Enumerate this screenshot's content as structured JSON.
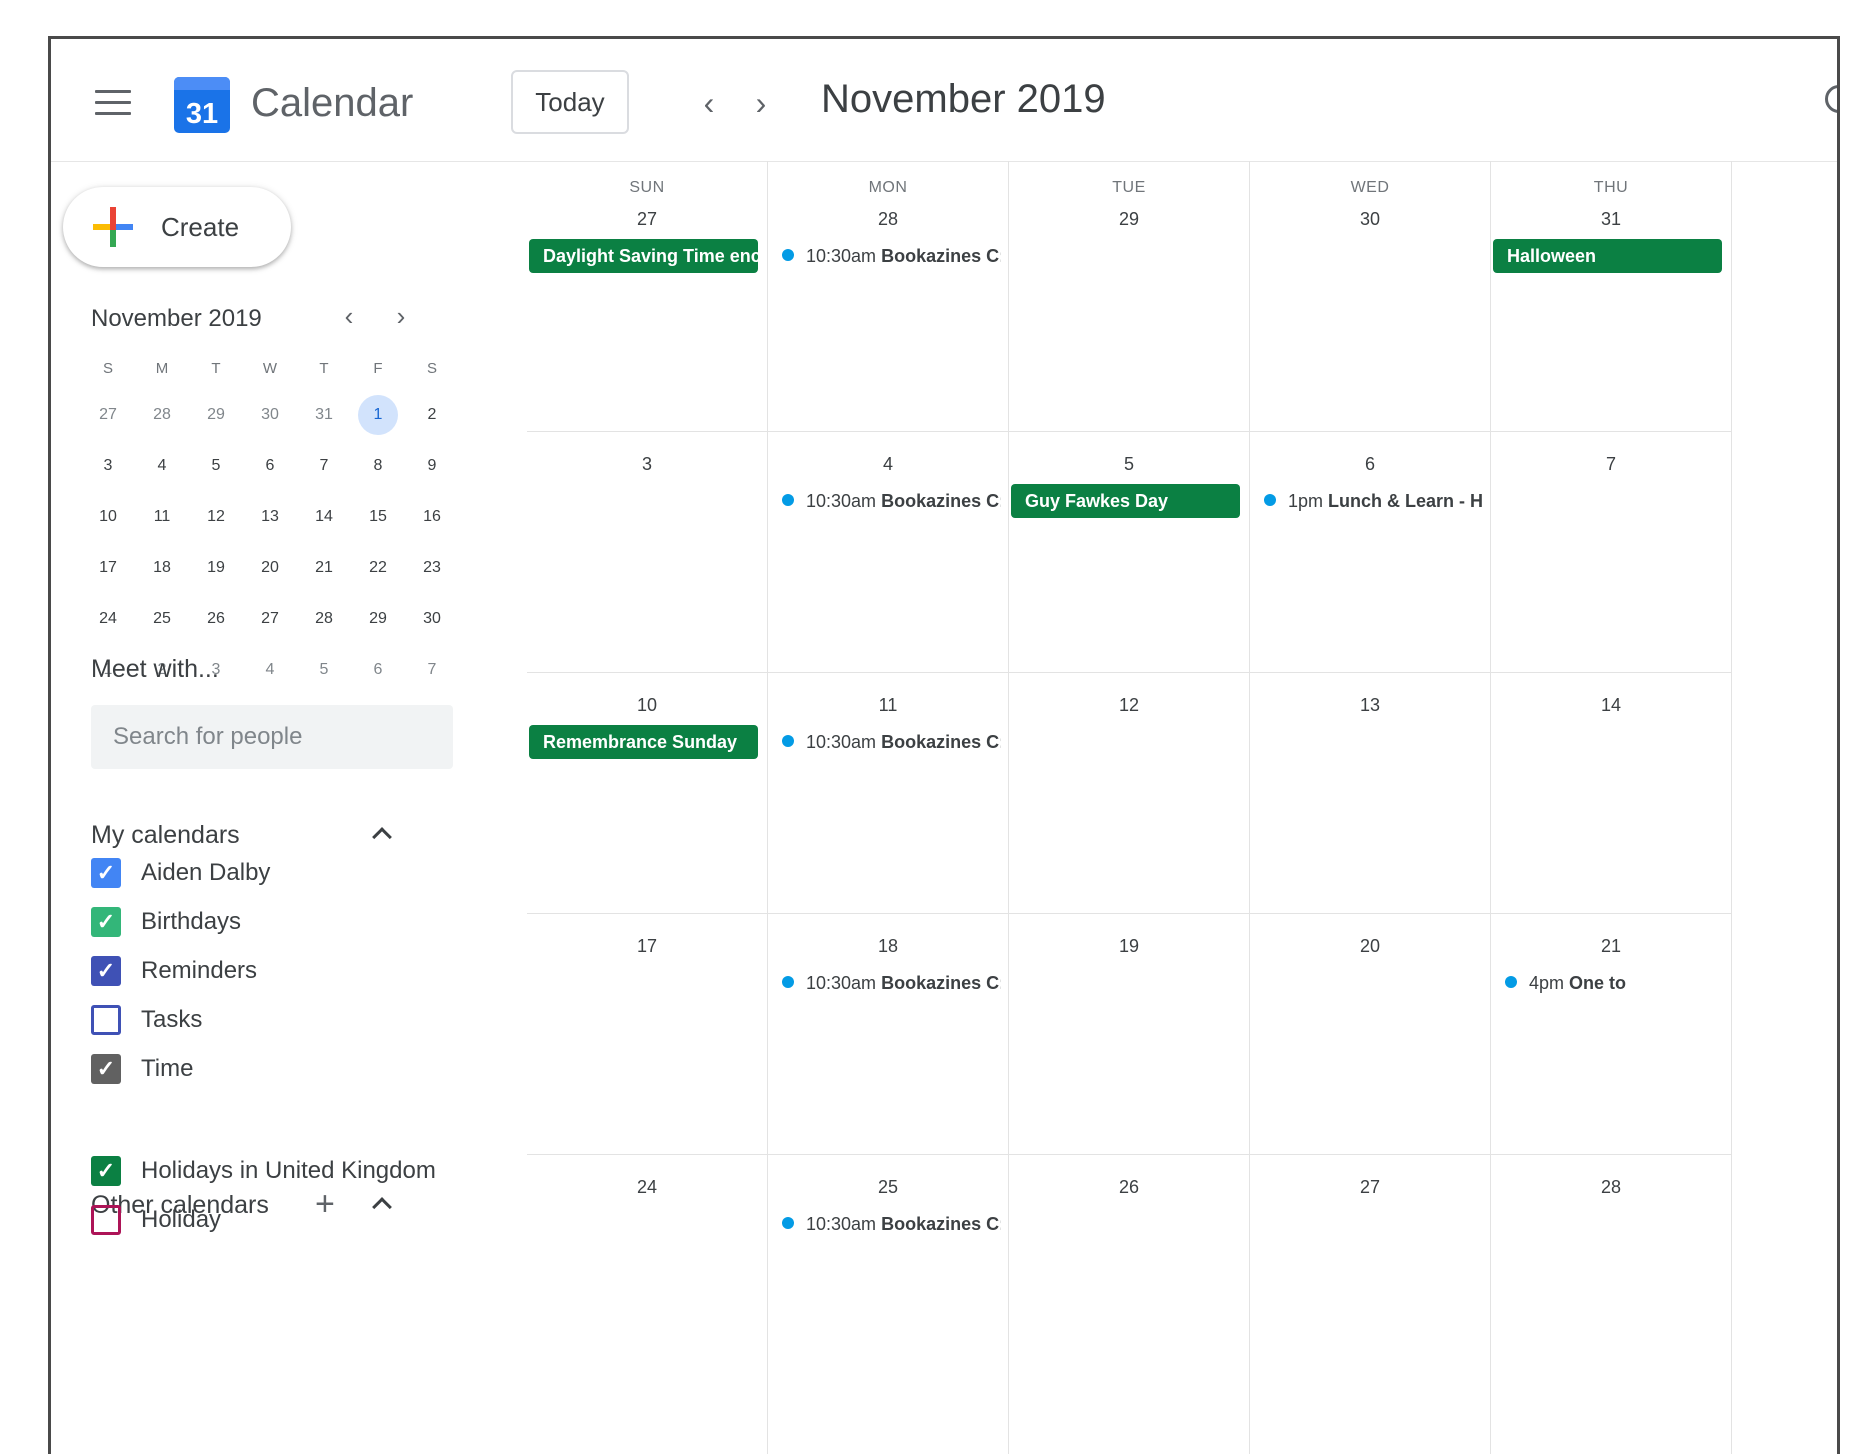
{
  "header": {
    "app_title": "Calendar",
    "logo_number": "31",
    "today_label": "Today",
    "prev_symbol": "‹",
    "next_symbol": "›",
    "period_title": "November 2019"
  },
  "sidebar": {
    "create_label": "Create",
    "mini_calendar": {
      "title": "November 2019",
      "prev_symbol": "‹",
      "next_symbol": "›",
      "weekdays": [
        "S",
        "M",
        "T",
        "W",
        "T",
        "F",
        "S"
      ],
      "weeks": [
        [
          "27",
          "28",
          "29",
          "30",
          "31",
          "1",
          "2"
        ],
        [
          "3",
          "4",
          "5",
          "6",
          "7",
          "8",
          "9"
        ],
        [
          "10",
          "11",
          "12",
          "13",
          "14",
          "15",
          "16"
        ],
        [
          "17",
          "18",
          "19",
          "20",
          "21",
          "22",
          "23"
        ],
        [
          "24",
          "25",
          "26",
          "27",
          "28",
          "29",
          "30"
        ],
        [
          "1",
          "2",
          "3",
          "4",
          "5",
          "6",
          "7"
        ]
      ],
      "selected": "1"
    },
    "meet_with_label": "Meet with...",
    "search_people_placeholder": "Search for people",
    "my_calendars_label": "My calendars",
    "my_calendars": [
      {
        "label": "Aiden Dalby",
        "color": "#4285f4",
        "checked": true
      },
      {
        "label": "Birthdays",
        "color": "#33b679",
        "checked": true
      },
      {
        "label": "Reminders",
        "color": "#3f51b5",
        "checked": true
      },
      {
        "label": "Tasks",
        "color": "#3f51b5",
        "checked": false
      },
      {
        "label": "Time",
        "color": "#616161",
        "checked": true
      }
    ],
    "other_calendars_label": "Other calendars",
    "add_symbol": "+",
    "other_calendars": [
      {
        "label": "Holidays in United Kingdom",
        "color": "#0b8043",
        "checked": true
      },
      {
        "label": "Holiday",
        "color": "#ad1457",
        "checked": false
      }
    ]
  },
  "month_view": {
    "weekday_headers": [
      "SUN",
      "MON",
      "TUE",
      "WED",
      "THU"
    ],
    "weeks": [
      {
        "days": [
          {
            "num": "27",
            "events": [
              {
                "kind": "chip",
                "title": "Daylight Saving Time enc"
              }
            ]
          },
          {
            "num": "28",
            "events": [
              {
                "kind": "timed",
                "time": "10:30am",
                "title": "Bookazines C:"
              }
            ]
          },
          {
            "num": "29",
            "events": []
          },
          {
            "num": "30",
            "events": []
          },
          {
            "num": "31",
            "events": [
              {
                "kind": "chip",
                "title": "Halloween"
              }
            ]
          }
        ]
      },
      {
        "days": [
          {
            "num": "3",
            "events": []
          },
          {
            "num": "4",
            "events": [
              {
                "kind": "timed",
                "time": "10:30am",
                "title": "Bookazines C:"
              }
            ]
          },
          {
            "num": "5",
            "events": [
              {
                "kind": "chip",
                "title": "Guy Fawkes Day"
              }
            ]
          },
          {
            "num": "6",
            "events": [
              {
                "kind": "timed",
                "time": "1pm",
                "title": "Lunch & Learn - He"
              }
            ]
          },
          {
            "num": "7",
            "events": []
          }
        ]
      },
      {
        "days": [
          {
            "num": "10",
            "events": [
              {
                "kind": "chip",
                "title": "Remembrance Sunday"
              }
            ]
          },
          {
            "num": "11",
            "events": [
              {
                "kind": "timed",
                "time": "10:30am",
                "title": "Bookazines C:"
              }
            ]
          },
          {
            "num": "12",
            "events": []
          },
          {
            "num": "13",
            "events": []
          },
          {
            "num": "14",
            "events": []
          }
        ]
      },
      {
        "days": [
          {
            "num": "17",
            "events": []
          },
          {
            "num": "18",
            "events": [
              {
                "kind": "timed",
                "time": "10:30am",
                "title": "Bookazines C:"
              }
            ]
          },
          {
            "num": "19",
            "events": []
          },
          {
            "num": "20",
            "events": []
          },
          {
            "num": "21",
            "events": [
              {
                "kind": "timed",
                "time": "4pm",
                "title": "One to"
              }
            ]
          }
        ]
      },
      {
        "days": [
          {
            "num": "24",
            "events": []
          },
          {
            "num": "25",
            "events": [
              {
                "kind": "timed",
                "time": "10:30am",
                "title": "Bookazines C:"
              }
            ]
          },
          {
            "num": "26",
            "events": []
          },
          {
            "num": "27",
            "events": []
          },
          {
            "num": "28",
            "events": []
          }
        ]
      }
    ]
  }
}
